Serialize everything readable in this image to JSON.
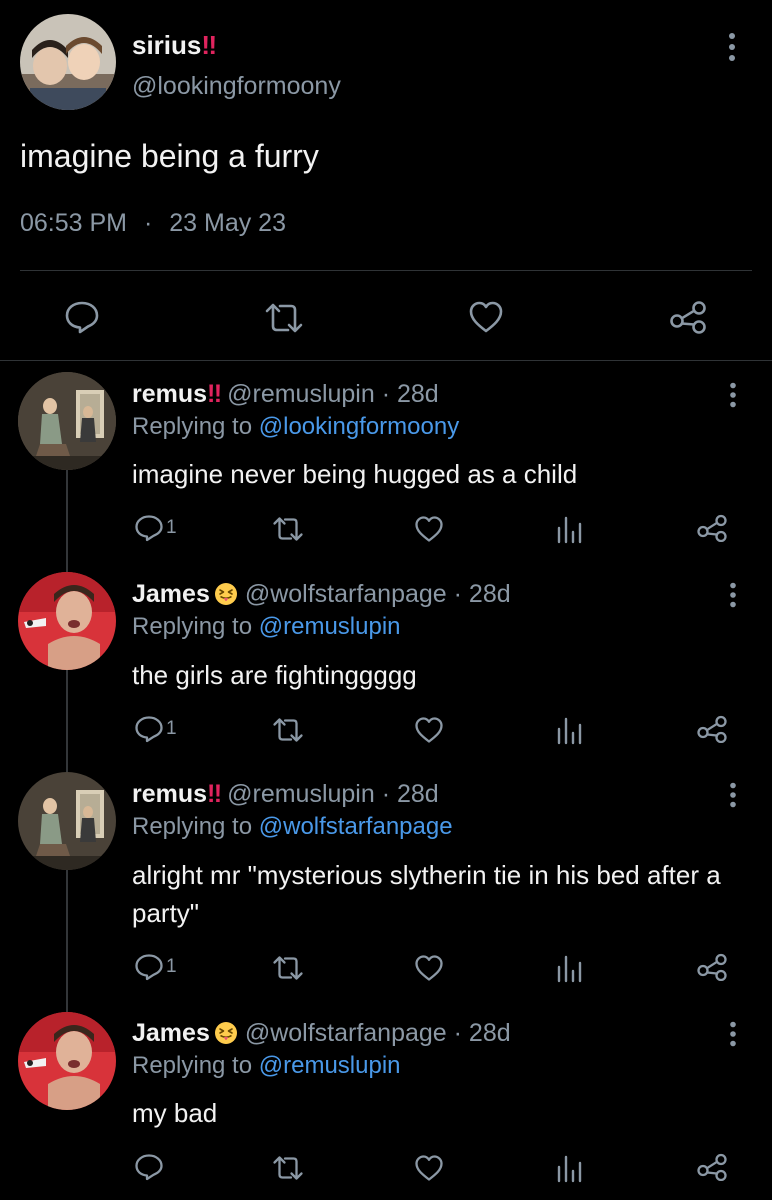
{
  "main_tweet": {
    "display_name": "sirius",
    "name_suffix": "‼",
    "handle": "@lookingformoony",
    "text": "imagine being a furry",
    "time": "06:53 PM",
    "separator": "·",
    "date": "23 May 23",
    "more_icon": "kebab-vertical-icon",
    "actions": [
      "reply-icon",
      "retweet-icon",
      "like-icon",
      "share-icon"
    ]
  },
  "replies": [
    {
      "display_name": "remus",
      "name_suffix": "‼",
      "handle": "@remuslupin",
      "age": "· 28d",
      "replying_label": "Replying to",
      "replying_to": "@lookingformoony",
      "text": "imagine never being hugged as a child",
      "reply_count": "1"
    },
    {
      "display_name": "James",
      "name_emoji": "squinting-tongue-face-emoji",
      "handle": "@wolfstarfanpage",
      "age": "· 28d",
      "replying_label": "Replying to",
      "replying_to": "@remuslupin",
      "text": "the girls are fightinggggg",
      "reply_count": "1"
    },
    {
      "display_name": "remus",
      "name_suffix": "‼",
      "handle": "@remuslupin",
      "age": "· 28d",
      "replying_label": "Replying to",
      "replying_to": "@wolfstarfanpage",
      "text": "alright mr \"mysterious slytherin tie in his bed after a party\"",
      "reply_count": "1"
    },
    {
      "display_name": "James",
      "name_emoji": "squinting-tongue-face-emoji",
      "handle": "@wolfstarfanpage",
      "age": "· 28d",
      "replying_label": "Replying to",
      "replying_to": "@remuslupin",
      "text": "my bad",
      "reply_count": ""
    }
  ],
  "colors": {
    "background": "#000000",
    "text": "#e7e9ea",
    "muted": "#8b98a5",
    "link": "#4a99e9",
    "bangs": "#e0245e",
    "divider": "#2f3336"
  }
}
